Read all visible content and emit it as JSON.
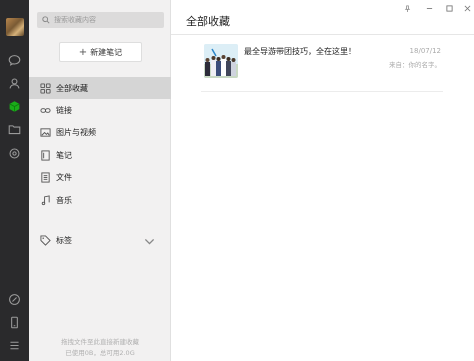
{
  "sidebar_rail": {
    "icons": [
      "avatar",
      "chat-icon",
      "contacts-icon",
      "favorites-icon",
      "folder-icon",
      "settings-icon",
      "mini-program-icon",
      "phone-icon",
      "menu-icon"
    ],
    "active_color": "#1aad19"
  },
  "search": {
    "placeholder": "搜索收藏内容"
  },
  "new_note": {
    "plus": "+",
    "label": "新建笔记"
  },
  "nav": {
    "all": "全部收藏",
    "links": "链接",
    "media": "图片与视频",
    "notes": "笔记",
    "files": "文件",
    "music": "音乐",
    "tags": "标签"
  },
  "footer": {
    "line1": "拖拽文件至此直接新建收藏",
    "line2": "已使用0B，总可用2.0G"
  },
  "main": {
    "title": "全部收藏",
    "items": [
      {
        "title": "最全导游带团技巧，全在这里！",
        "date": "18/07/12",
        "source": "来自：你的名字。"
      }
    ]
  }
}
